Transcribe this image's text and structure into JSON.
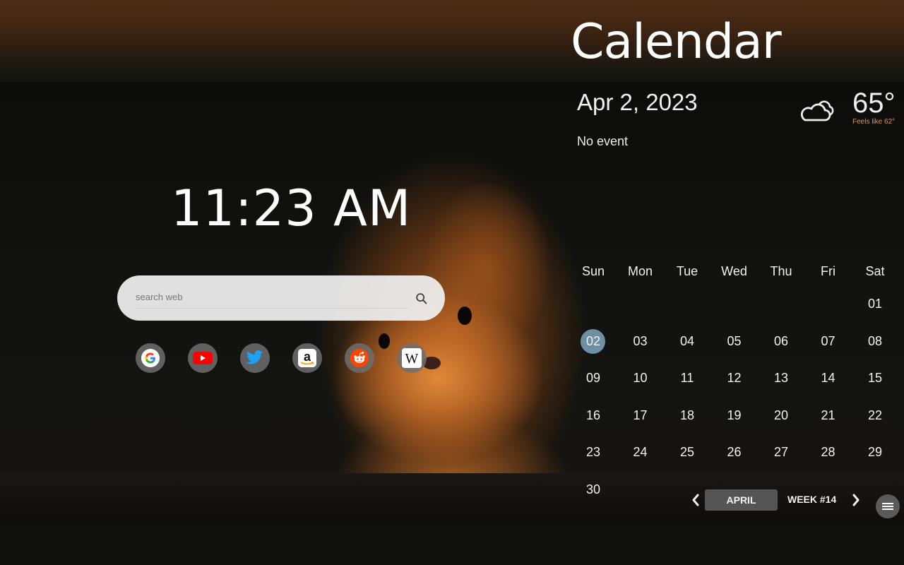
{
  "app_title": "Calendar",
  "clock": {
    "time": "11:23 AM"
  },
  "search": {
    "placeholder": "search web"
  },
  "shortcuts": [
    {
      "name": "Google",
      "icon": "google-icon"
    },
    {
      "name": "YouTube",
      "icon": "youtube-icon"
    },
    {
      "name": "Twitter",
      "icon": "twitter-icon"
    },
    {
      "name": "Amazon",
      "icon": "amazon-icon"
    },
    {
      "name": "Reddit",
      "icon": "reddit-icon"
    },
    {
      "name": "Wikipedia",
      "icon": "wikipedia-icon"
    }
  ],
  "calendar": {
    "date": "Apr 2, 2023",
    "event": "No event",
    "weekdays": [
      "Sun",
      "Mon",
      "Tue",
      "Wed",
      "Thu",
      "Fri",
      "Sat"
    ],
    "first_weekday_index": 6,
    "days": [
      "01",
      "02",
      "03",
      "04",
      "05",
      "06",
      "07",
      "08",
      "09",
      "10",
      "11",
      "12",
      "13",
      "14",
      "15",
      "16",
      "17",
      "18",
      "19",
      "20",
      "21",
      "22",
      "23",
      "24",
      "25",
      "26",
      "27",
      "28",
      "29",
      "30"
    ],
    "today": "02",
    "today_color": "#6f8fa3",
    "month_label": "APRIL",
    "week_label": "WEEK #14"
  },
  "weather": {
    "icon": "cloudy-icon",
    "temperature": "65°",
    "feels_like": "Feels like 62°",
    "feels_like_color": "#d89a5c"
  }
}
